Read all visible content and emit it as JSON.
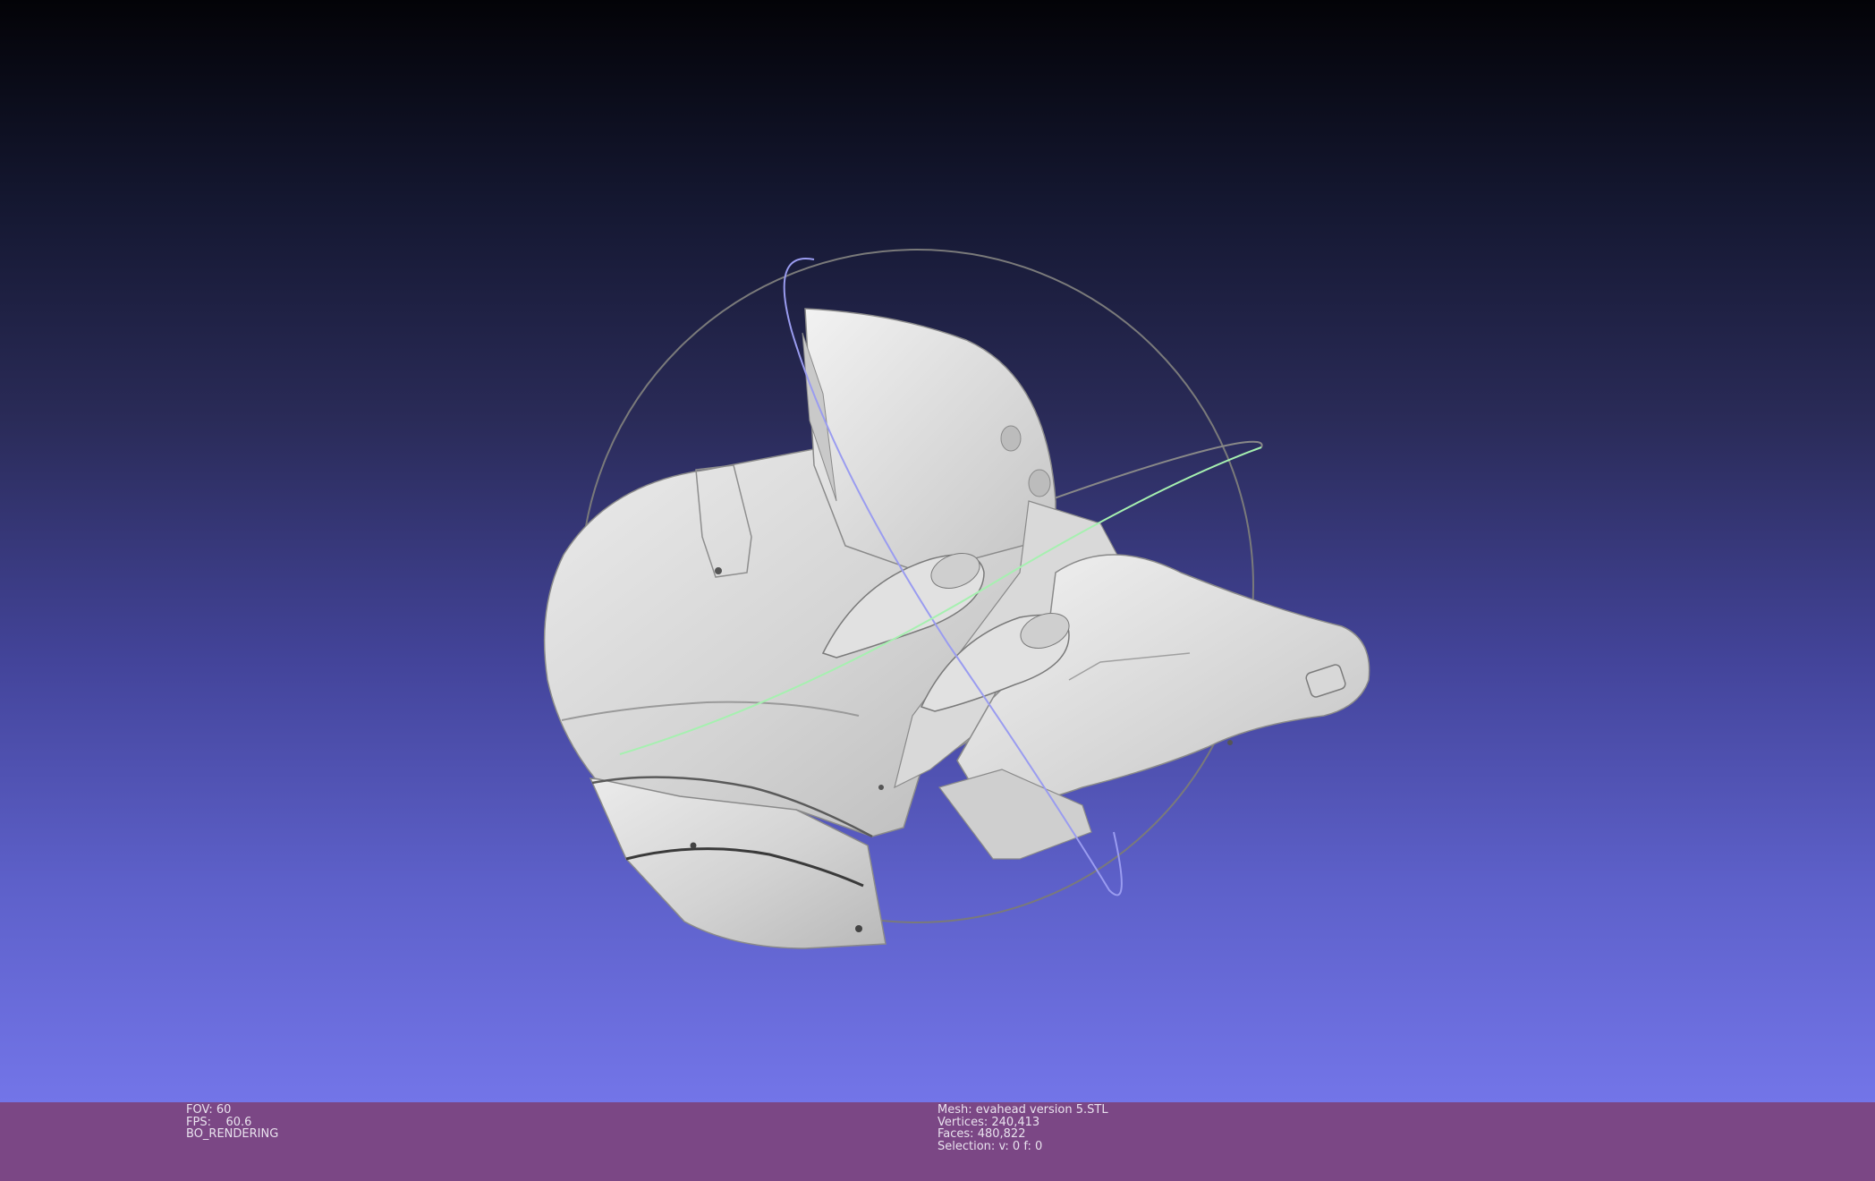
{
  "app": {
    "name": "MeshLab 3D viewport"
  },
  "render_info": {
    "fov_label": "FOV:",
    "fov_value": "60",
    "fps_label": "FPS:",
    "fps_value": "60.6",
    "mode": "BO_RENDERING"
  },
  "mesh_info": {
    "mesh_label": "Mesh:",
    "mesh_name": "evahead version 5.STL",
    "vertices_label": "Vertices:",
    "vertices": "240,413",
    "faces_label": "Faces:",
    "faces": "480,822",
    "selection_label": "Selection:",
    "selection": "v: 0 f: 0"
  },
  "colors": {
    "background_top": "#030307",
    "background_bottom": "#7375e8",
    "statusbar": "#7b4785",
    "model": "#d6d6d6",
    "trackball_circle": "#7a7a7a",
    "trackball_blue": "#9a9cf0",
    "trackball_green": "#a6f0b0"
  },
  "icons": [
    "trackball-gizmo",
    "mesh-model"
  ]
}
